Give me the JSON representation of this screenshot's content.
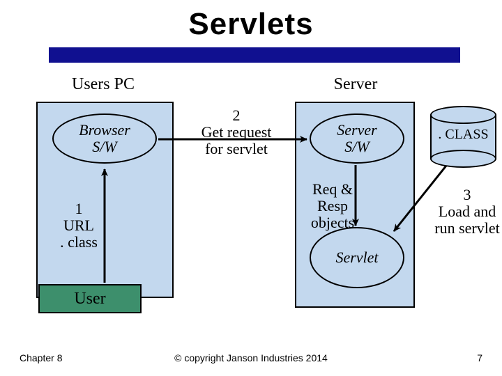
{
  "title": "Servlets",
  "labels": {
    "users_pc": "Users PC",
    "server": "Server",
    "browser_sw": "Browser\nS/W",
    "server_sw": "Server\nS/W",
    "servlet": "Servlet",
    "user": "User",
    "class_db": ". CLASS"
  },
  "steps": {
    "s1": "1\nURL\n. class",
    "s2": "2\nGet request\nfor servlet",
    "s3": "3\nLoad and\nrun servlet",
    "reqresp": "Req &\nResp\nobjects"
  },
  "footer": {
    "left": "Chapter 8",
    "center": "© copyright Janson Industries 2014",
    "right": "7"
  }
}
